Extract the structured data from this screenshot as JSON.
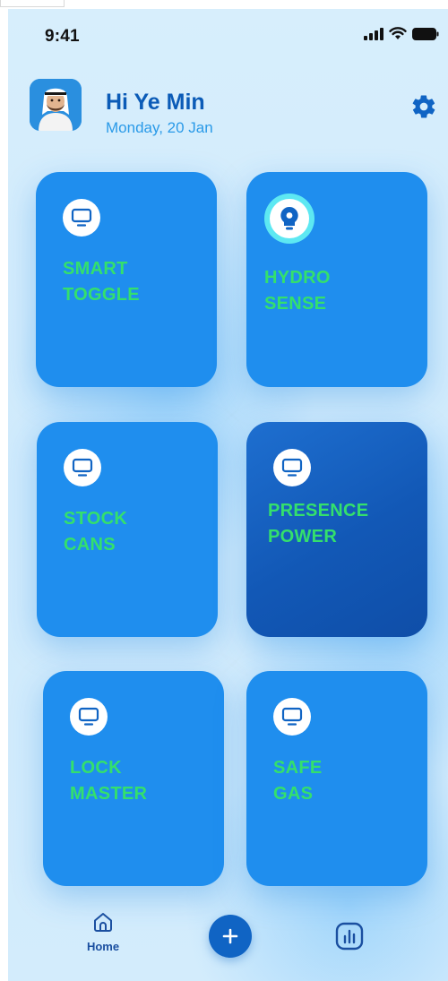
{
  "status_bar": {
    "time": "9:41",
    "icons": [
      "signal-icon",
      "wifi-icon",
      "battery-icon"
    ]
  },
  "header": {
    "greeting": "Hi Ye Min",
    "date": "Monday, 20 Jan",
    "settings_icon": "gear-icon"
  },
  "devices": [
    {
      "label": "SMART\nTOGGLE",
      "icon": "monitor-icon"
    },
    {
      "label": "HYDRO\nSENSE",
      "icon": "bulb-icon"
    },
    {
      "label": "STOCK\nCANS",
      "icon": "monitor-icon"
    },
    {
      "label": "PRESENCE\nPOWER",
      "icon": "monitor-icon"
    },
    {
      "label": "LOCK\nMASTER",
      "icon": "monitor-icon"
    },
    {
      "label": "SAFE\nGAS",
      "icon": "monitor-icon"
    }
  ],
  "bottom_nav": {
    "home_label": "Home",
    "add_icon": "plus-icon",
    "stats_icon": "bar-chart-icon"
  },
  "colors": {
    "primary": "#1F8EEE",
    "primary_dark": "#1258B6",
    "accent_text": "#34E06C",
    "title_blue": "#0B5BB7",
    "date_blue": "#2A9AE8",
    "background": "#D7EEFC"
  }
}
